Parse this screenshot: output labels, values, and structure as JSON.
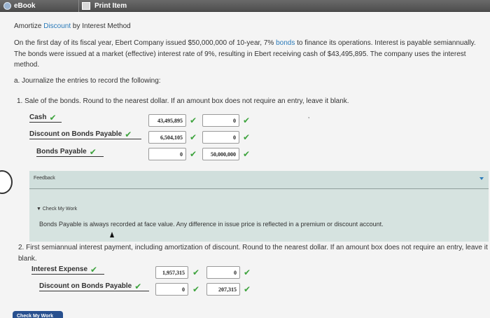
{
  "toolbar": {
    "ebook_label": "eBook",
    "print_label": "Print Item"
  },
  "title": {
    "prefix": "Amortize ",
    "link": "Discount",
    "suffix": " by Interest Method"
  },
  "intro": {
    "part1": "On the first day of its fiscal year, Ebert Company issued $50,000,000 of 10-year, 7% ",
    "link": "bonds",
    "part2": " to finance its operations. Interest is payable semiannually. The bonds were issued at a market (effective) interest rate of 9%, resulting in Ebert receiving cash of $43,495,895. The company uses the interest method."
  },
  "part_a": "a.  Journalize the entries to record the following:",
  "q1": {
    "text": "1.  Sale of the bonds. Round to the nearest dollar. If an amount box does not require an entry, leave it blank.",
    "rows": [
      {
        "account": "Cash",
        "debit": "43,495,895",
        "credit": "0"
      },
      {
        "account": "Discount on Bonds Payable",
        "debit": "6,504,105",
        "credit": "0"
      },
      {
        "account": "Bonds Payable",
        "debit": "0",
        "credit": "50,000,000"
      }
    ]
  },
  "feedback": {
    "label": "Feedback",
    "check_my_work": "▼ Check My Work",
    "text": "Bonds Payable is always recorded at face value. Any difference in issue price is reflected in a premium or discount account."
  },
  "q2": {
    "text": "2.  First semiannual interest payment, including amortization of discount. Round to the nearest dollar. If an amount box does not require an entry, leave it blank.",
    "rows": [
      {
        "account": "Interest Expense",
        "debit": "1,957,315",
        "credit": "0"
      },
      {
        "account": "Discount on Bonds Payable",
        "debit": "0",
        "credit": "207,315"
      }
    ]
  },
  "check_button": "Check My Work",
  "check_glyph": "✔",
  "colors": {
    "accent": "#2a7ab9",
    "correct": "#3da33d",
    "button": "#28508f"
  }
}
